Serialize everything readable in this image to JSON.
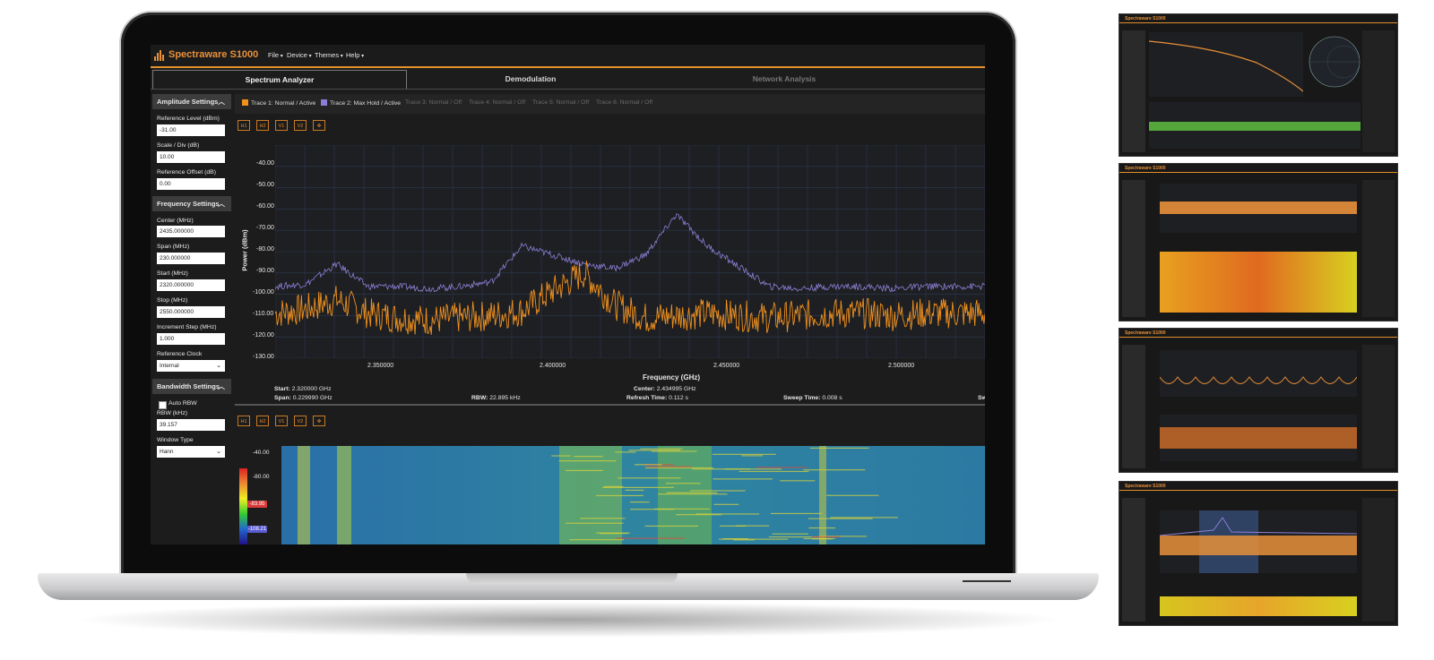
{
  "app": {
    "title": "Spectraware S1000",
    "menu": [
      "File",
      "Device",
      "Themes",
      "Help"
    ],
    "accent_color": "#e8903a"
  },
  "tabs": [
    {
      "label": "Spectrum Analyzer",
      "active": true
    },
    {
      "label": "Demodulation",
      "active": false
    },
    {
      "label": "Network Analysis",
      "active": false
    }
  ],
  "sidebar": {
    "amplitude": {
      "header": "Amplitude Settings",
      "reference_level_label": "Reference Level (dBm)",
      "reference_level_value": "-31.00",
      "scale_label": "Scale / Div (dB)",
      "scale_value": "10.00",
      "offset_label": "Reference Offset (dB)",
      "offset_value": "0.00"
    },
    "frequency": {
      "header": "Frequency Settings",
      "center_label": "Center (MHz)",
      "center_value": "2435.000000",
      "span_label": "Span (MHz)",
      "span_value": "230.000000",
      "start_label": "Start (MHz)",
      "start_value": "2320.000000",
      "stop_label": "Stop (MHz)",
      "stop_value": "2550.000000",
      "increment_label": "Increment Step (MHz)",
      "increment_value": "1.000",
      "clock_label": "Reference Clock",
      "clock_value": "Internal"
    },
    "bandwidth": {
      "header": "Bandwidth Settings",
      "auto_rbw_label": "Auto RBW",
      "auto_rbw_checked": false,
      "rbw_label": "RBW (kHz)",
      "rbw_value": "39.157",
      "window_label": "Window Type",
      "window_value": "Hann"
    }
  },
  "traces": [
    {
      "label": "Trace 1: Normal / Active",
      "color": "#f0911e",
      "active": true
    },
    {
      "label": "Trace 2: Max Hold / Active",
      "color": "#8a7fd6",
      "active": true
    },
    {
      "label": "Trace 3: Normal / Off",
      "active": false
    },
    {
      "label": "Trace 4: Normal / Off",
      "active": false
    },
    {
      "label": "Trace 5: Normal / Off",
      "active": false
    },
    {
      "label": "Trace 6: Normal / Off",
      "active": false
    }
  ],
  "toolbar": [
    "H1",
    "H2",
    "V1",
    "V2",
    "✥"
  ],
  "spectrum": {
    "y_axis_title": "Power (dBm)",
    "x_axis_title": "Frequency (GHz)",
    "y_ticks": [
      "-40.00",
      "-50.00",
      "-60.00",
      "-70.00",
      "-80.00",
      "-90.00",
      "-100.00",
      "-110.00",
      "-120.00",
      "-130.00"
    ],
    "x_ticks": [
      "2.350000",
      "2.400000",
      "2.450000",
      "2.500000"
    ]
  },
  "status": {
    "start_label": "Start:",
    "start_value": "2.320000 GHz",
    "span_label": "Span:",
    "span_value": "0.229990 GHz",
    "rbw_label": "RBW:",
    "rbw_value": "22.895 kHz",
    "center_label": "Center:",
    "center_value": "2.434995 GHz",
    "refresh_label": "Refresh Time:",
    "refresh_value": "0.112 s",
    "sweep_label": "Sweep Time:",
    "sweep_value": "0.008 s",
    "cut_label": "Sw"
  },
  "waterfall": {
    "y_ticks": [
      "-40.00",
      "-80.00"
    ],
    "colorbar_tags": [
      "-83.95",
      "-108.21"
    ]
  },
  "chart_data": {
    "type": "line",
    "xlabel": "Frequency (GHz)",
    "ylabel": "Power (dBm)",
    "xlim": [
      2.32,
      2.55
    ],
    "ylim": [
      -130,
      -35
    ],
    "series": [
      {
        "name": "Trace 1: Normal / Active",
        "color": "#f0911e",
        "x": [
          2.32,
          2.33,
          2.34,
          2.35,
          2.36,
          2.37,
          2.38,
          2.39,
          2.4,
          2.41,
          2.42,
          2.43,
          2.44,
          2.45,
          2.46,
          2.47,
          2.48,
          2.49,
          2.5,
          2.51,
          2.52,
          2.53,
          2.55
        ],
        "values": [
          -110,
          -108,
          -104,
          -110,
          -112,
          -113,
          -112,
          -111,
          -109,
          -100,
          -92,
          -106,
          -112,
          -111,
          -110,
          -111,
          -112,
          -111,
          -110,
          -110,
          -111,
          -110,
          -110
        ]
      },
      {
        "name": "Trace 2: Max Hold / Active",
        "color": "#8a7fd6",
        "x": [
          2.32,
          2.33,
          2.34,
          2.35,
          2.36,
          2.37,
          2.38,
          2.39,
          2.4,
          2.41,
          2.42,
          2.43,
          2.44,
          2.45,
          2.46,
          2.47,
          2.48,
          2.49,
          2.5,
          2.51,
          2.52,
          2.53,
          2.55
        ],
        "values": [
          -98,
          -97,
          -88,
          -98,
          -98,
          -99,
          -98,
          -96,
          -80,
          -84,
          -88,
          -90,
          -84,
          -66,
          -80,
          -89,
          -98,
          -99,
          -98,
          -98,
          -99,
          -98,
          -98
        ]
      }
    ]
  }
}
